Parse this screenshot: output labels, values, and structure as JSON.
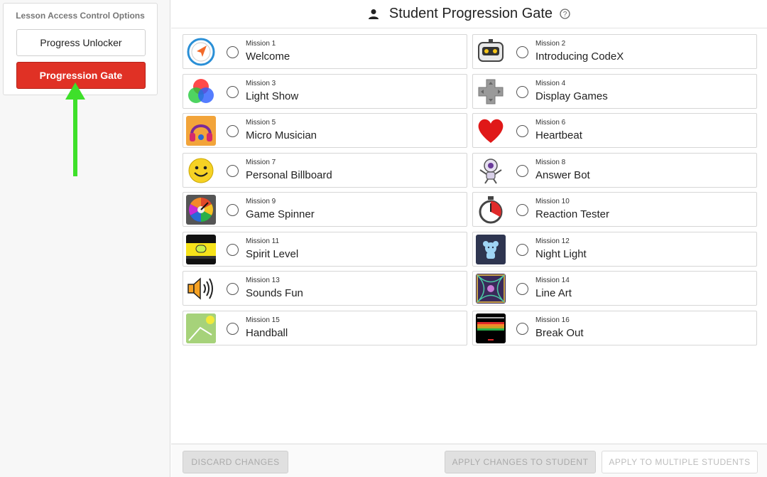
{
  "sidebar": {
    "title": "Lesson Access Control Options",
    "progress_unlocker_label": "Progress Unlocker",
    "progression_gate_label": "Progression Gate",
    "active_color": "#e03125",
    "highlight_arrow_color": "#3ee02a"
  },
  "header": {
    "title": "Student Progression Gate",
    "icons": [
      "person-icon",
      "help-icon"
    ]
  },
  "missions": [
    {
      "number": "Mission 1",
      "name": "Welcome",
      "icon": "compass"
    },
    {
      "number": "Mission 2",
      "name": "Introducing CodeX",
      "icon": "robot"
    },
    {
      "number": "Mission 3",
      "name": "Light Show",
      "icon": "rgb-circles"
    },
    {
      "number": "Mission 4",
      "name": "Display Games",
      "icon": "dpad"
    },
    {
      "number": "Mission 5",
      "name": "Micro Musician",
      "icon": "headphones"
    },
    {
      "number": "Mission 6",
      "name": "Heartbeat",
      "icon": "heart"
    },
    {
      "number": "Mission 7",
      "name": "Personal Billboard",
      "icon": "smiley"
    },
    {
      "number": "Mission 8",
      "name": "Answer Bot",
      "icon": "answer-robot"
    },
    {
      "number": "Mission 9",
      "name": "Game Spinner",
      "icon": "spinner-wheel"
    },
    {
      "number": "Mission 10",
      "name": "Reaction Tester",
      "icon": "stopwatch"
    },
    {
      "number": "Mission 11",
      "name": "Spirit Level",
      "icon": "spirit-level"
    },
    {
      "number": "Mission 12",
      "name": "Night Light",
      "icon": "night-light-bear"
    },
    {
      "number": "Mission 13",
      "name": "Sounds Fun",
      "icon": "speaker"
    },
    {
      "number": "Mission 14",
      "name": "Line Art",
      "icon": "line-art"
    },
    {
      "number": "Mission 15",
      "name": "Handball",
      "icon": "handball"
    },
    {
      "number": "Mission 16",
      "name": "Break Out",
      "icon": "breakout"
    }
  ],
  "footer": {
    "discard_label": "DISCARD CHANGES",
    "apply_student_label": "APPLY CHANGES TO STUDENT",
    "apply_multiple_label": "APPLY TO MULTIPLE STUDENTS"
  }
}
